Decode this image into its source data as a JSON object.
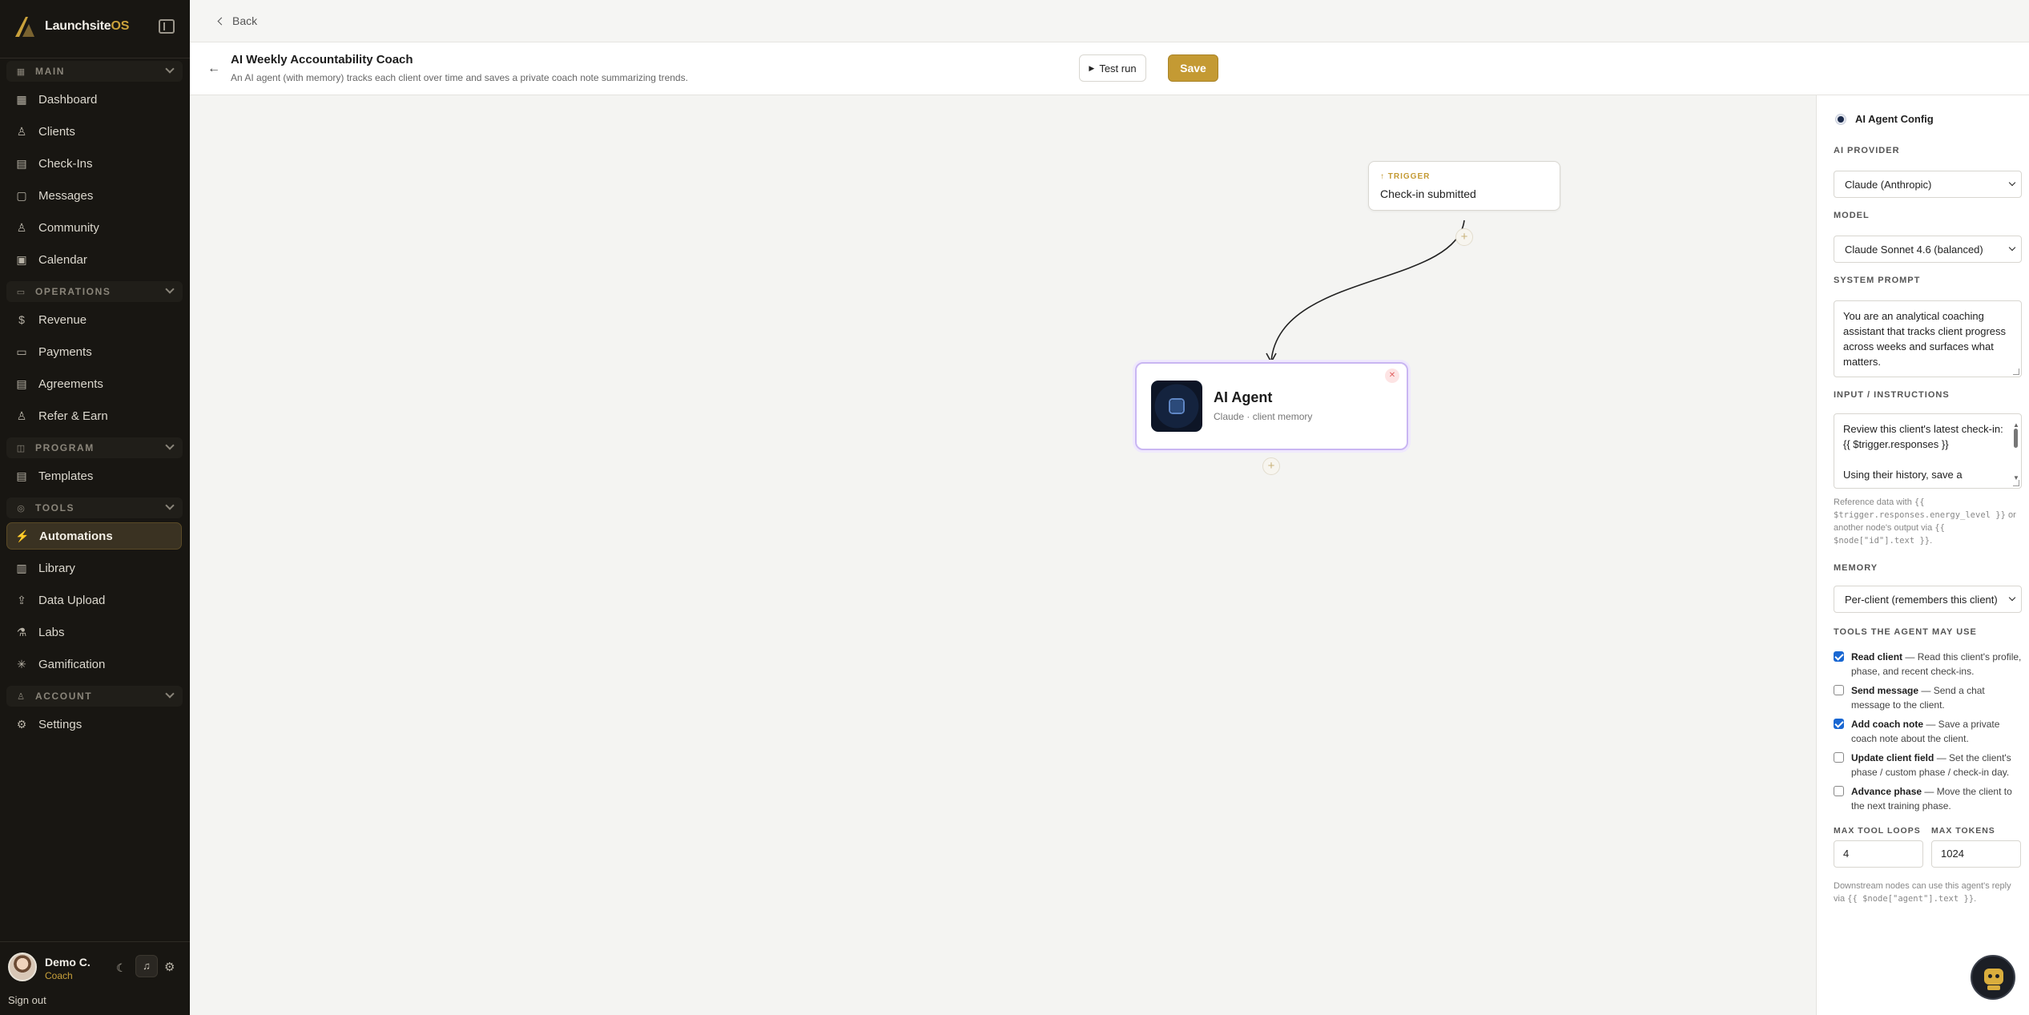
{
  "brand": {
    "name": "Launchsite",
    "suffix": "OS"
  },
  "sidebar": {
    "sections": [
      {
        "label": "MAIN",
        "icon": "grid-icon"
      },
      {
        "label": "OPERATIONS",
        "icon": "briefcase-icon"
      },
      {
        "label": "PROGRAM",
        "icon": "layers-icon"
      },
      {
        "label": "TOOLS",
        "icon": "wrench-icon"
      },
      {
        "label": "ACCOUNT",
        "icon": "user-icon"
      }
    ],
    "items": [
      {
        "label": "Dashboard",
        "icon": "grid-icon"
      },
      {
        "label": "Clients",
        "icon": "users-icon"
      },
      {
        "label": "Check-Ins",
        "icon": "clipboard-icon"
      },
      {
        "label": "Messages",
        "icon": "chat-icon"
      },
      {
        "label": "Community",
        "icon": "people-icon"
      },
      {
        "label": "Calendar",
        "icon": "calendar-icon"
      },
      {
        "label": "Revenue",
        "icon": "dollar-icon"
      },
      {
        "label": "Payments",
        "icon": "card-icon"
      },
      {
        "label": "Agreements",
        "icon": "document-icon"
      },
      {
        "label": "Refer & Earn",
        "icon": "gift-icon"
      },
      {
        "label": "Templates",
        "icon": "template-icon"
      },
      {
        "label": "Automations",
        "icon": "bolt-icon",
        "active": true
      },
      {
        "label": "Library",
        "icon": "book-icon"
      },
      {
        "label": "Data Upload",
        "icon": "upload-icon"
      },
      {
        "label": "Labs",
        "icon": "flask-icon"
      },
      {
        "label": "Gamification",
        "icon": "sparkle-icon"
      },
      {
        "label": "Settings",
        "icon": "gear-icon"
      }
    ]
  },
  "user": {
    "name": "Demo C.",
    "role": "Coach",
    "sign_out": "Sign out"
  },
  "topbar": {
    "back_label": "Back"
  },
  "header": {
    "title": "AI Weekly Accountability Coach",
    "subtitle": "An AI agent (with memory) tracks each client over time and saves a private coach note summarizing trends.",
    "test_run_label": "Test run",
    "save_label": "Save"
  },
  "canvas": {
    "trigger": {
      "tag": "TRIGGER",
      "label": "Check-in submitted"
    },
    "agent": {
      "title": "AI Agent",
      "subtitle": "Claude · client memory"
    }
  },
  "panel": {
    "title": "AI Agent Config",
    "provider_label": "AI PROVIDER",
    "provider_value": "Claude (Anthropic)",
    "model_label": "MODEL",
    "model_value": "Claude Sonnet 4.6 (balanced)",
    "system_prompt_label": "SYSTEM PROMPT",
    "system_prompt_value": "You are an analytical coaching assistant that tracks client progress across weeks and surfaces what matters.",
    "instructions_label": "INPUT / INSTRUCTIONS",
    "instructions_line1": "Review this client's latest check-in:",
    "instructions_line2": "{{ $trigger.responses }}",
    "instructions_line3": "Using their history, save a",
    "ref_hint_1": "Reference data with",
    "ref_hint_code1": "{{ $trigger.responses.energy_level }}",
    "ref_hint_2": "or another node's output via",
    "ref_hint_code2": "{{ $node[\"id\"].text }}",
    "memory_label": "MEMORY",
    "memory_value": "Per-client (remembers this client)",
    "tools_label": "TOOLS THE AGENT MAY USE",
    "tools": [
      {
        "name": "Read client",
        "desc": " — Read this client's profile, phase, and recent check-ins.",
        "checked": true
      },
      {
        "name": "Send message",
        "desc": " — Send a chat message to the client.",
        "checked": false
      },
      {
        "name": "Add coach note",
        "desc": " — Save a private coach note about the client.",
        "checked": true
      },
      {
        "name": "Update client field",
        "desc": " — Set the client's phase / custom phase / check-in day.",
        "checked": false
      },
      {
        "name": "Advance phase",
        "desc": " — Move the client to the next training phase.",
        "checked": false
      }
    ],
    "max_loops_label": "MAX TOOL LOOPS",
    "max_loops_value": "4",
    "max_tokens_label": "MAX TOKENS",
    "max_tokens_value": "1024",
    "downstream_hint": "Downstream nodes can use this agent's reply via",
    "downstream_code": "{{ $node[\"agent\"].text }}"
  }
}
